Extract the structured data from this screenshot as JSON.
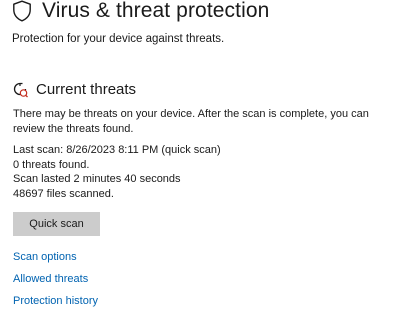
{
  "header": {
    "title": "Virus & threat protection",
    "icon": "shield-icon"
  },
  "subtitle": "Protection for your device against threats.",
  "current_threats": {
    "icon": "virus-scan-icon",
    "title": "Current threats",
    "description": "There may be threats on your device. After the scan is complete, you can review the threats found.",
    "last_scan": "Last scan: 8/26/2023 8:11 PM (quick scan)",
    "threats_found": "0 threats found.",
    "duration": "Scan lasted 2 minutes 40 seconds",
    "files_scanned": "48697 files scanned."
  },
  "actions": {
    "quick_scan_label": "Quick scan"
  },
  "links": {
    "scan_options": "Scan options",
    "allowed_threats": "Allowed threats",
    "protection_history": "Protection history"
  },
  "colors": {
    "link": "#0063b1",
    "button_bg": "#cccccc",
    "text": "#1a1a1a"
  }
}
